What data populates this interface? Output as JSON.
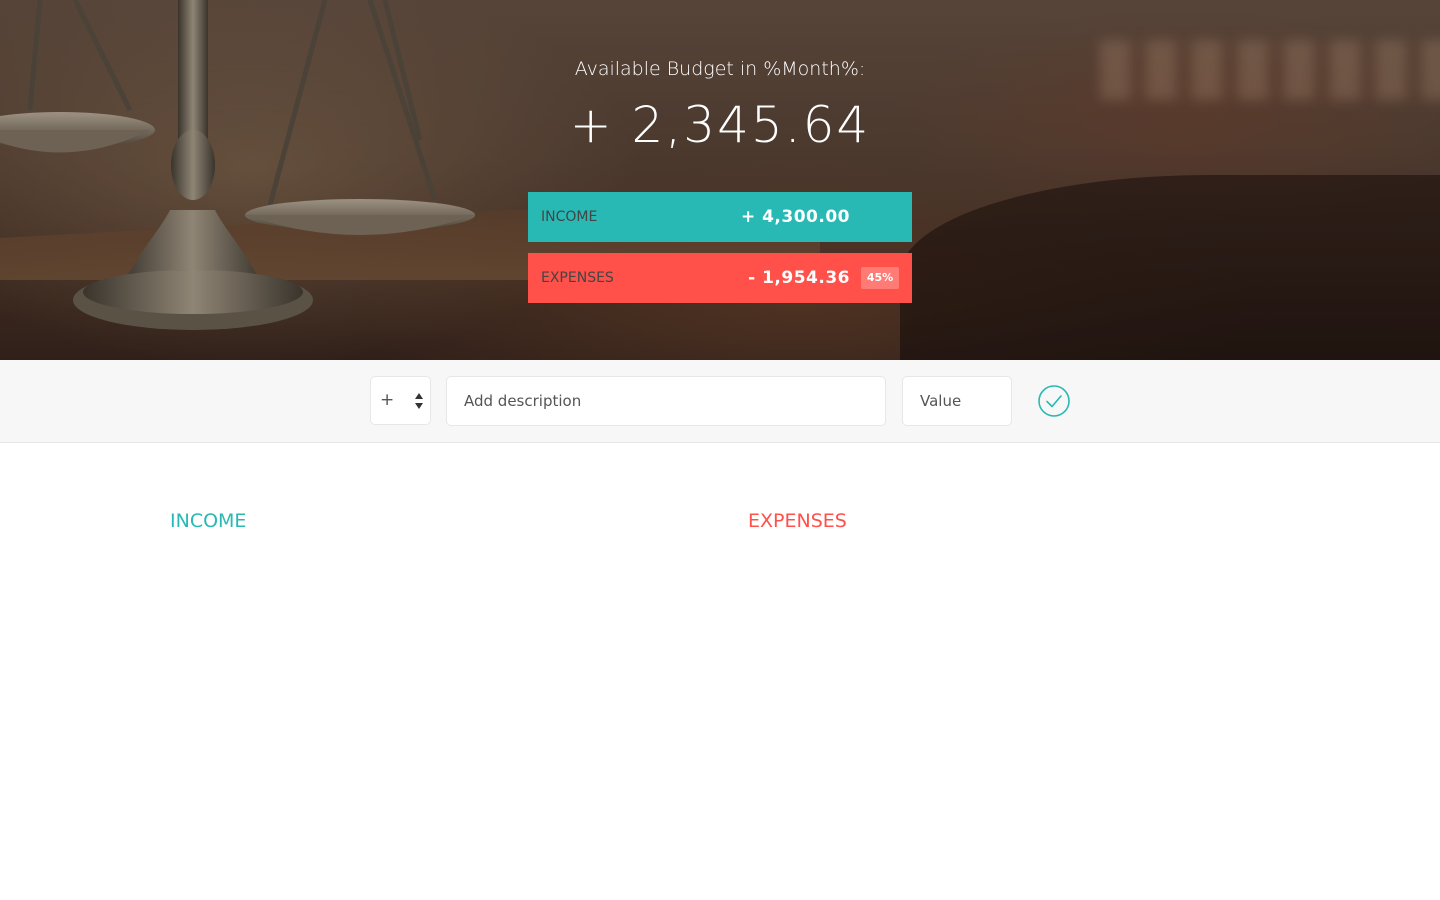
{
  "budget": {
    "title": "Available Budget in %Month%:",
    "value": "+ 2,345.64",
    "income": {
      "label": "Income",
      "value": "+ 4,300.00"
    },
    "expenses": {
      "label": "Expenses",
      "value": "- 1,954.36",
      "percentage": "45%"
    }
  },
  "add_form": {
    "type_selected": "+",
    "description_placeholder": "Add description",
    "value_placeholder": "Value",
    "submit_icon": "check-circle-icon"
  },
  "lists": {
    "income_title": "Income",
    "expenses_title": "Expenses"
  },
  "colors": {
    "income": "#28B9B5",
    "expenses": "#FF5049"
  }
}
